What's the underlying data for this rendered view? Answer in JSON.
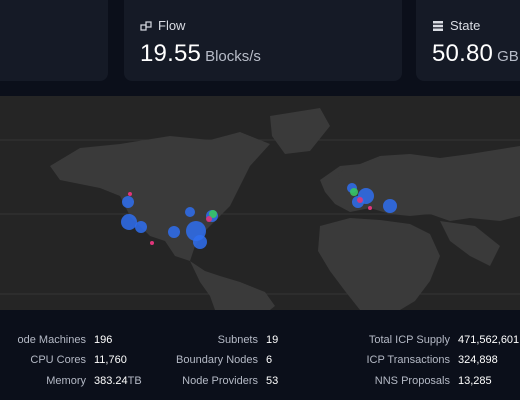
{
  "cards": {
    "flow": {
      "title": "Flow",
      "value": "19.55",
      "unit": "Blocks/s",
      "icon": "blocks-icon"
    },
    "state": {
      "title": "State",
      "value": "50.80",
      "unit": "GB",
      "icon": "database-icon"
    }
  },
  "stats": {
    "col1": [
      {
        "label": "ode Machines",
        "value": "196"
      },
      {
        "label": "CPU Cores",
        "value": "11,760"
      },
      {
        "label": "Memory",
        "value": "383.24",
        "suffix": "TB"
      }
    ],
    "col2": [
      {
        "label": "Subnets",
        "value": "19"
      },
      {
        "label": "Boundary Nodes",
        "value": "6"
      },
      {
        "label": "Node Providers",
        "value": "53"
      }
    ],
    "col3": [
      {
        "label": "Total ICP Supply",
        "value": "471,562,601"
      },
      {
        "label": "ICP Transactions",
        "value": "324,898"
      },
      {
        "label": "NNS Proposals",
        "value": "13,285"
      }
    ]
  },
  "colors": {
    "background": "#0b0f1a",
    "card": "#151a26",
    "map_land": "#3a3a3a",
    "map_water": "#252525",
    "node_blue": "#2f6ff0",
    "node_green": "#39c463",
    "node_pink": "#e0357a"
  }
}
